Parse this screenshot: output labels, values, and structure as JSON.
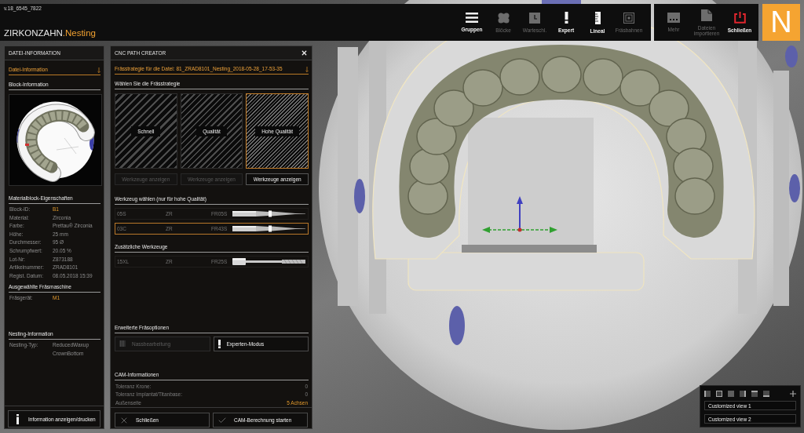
{
  "version": "v.18_6545_7822",
  "app_name": {
    "brand": "ZIRKONZAHN",
    "product": ".Nesting"
  },
  "toolbar": [
    {
      "label": "Gruppen",
      "kind": "groups",
      "disabled": false
    },
    {
      "label": "Blöcke",
      "kind": "blocks",
      "disabled": true
    },
    {
      "label": "Warteschl.",
      "kind": "queue",
      "disabled": true
    },
    {
      "label": "Expert",
      "kind": "expert",
      "disabled": false
    },
    {
      "label": "Lineal",
      "kind": "ruler",
      "disabled": false
    },
    {
      "label": "Fräsbahnen",
      "kind": "paths",
      "disabled": true
    }
  ],
  "side_toolbar": [
    {
      "label": "Mehr",
      "kind": "more",
      "disabled": true
    },
    {
      "label": "Dateien importieren",
      "kind": "import",
      "disabled": true
    },
    {
      "label": "Schließen",
      "kind": "power",
      "disabled": false
    }
  ],
  "logo": "N",
  "file_info_panel": {
    "title": "DATEI-INFORMATION",
    "file_section": "Datei-Information",
    "block_section": "Block-Information",
    "material_section": "Materialblock-Eigenschaften",
    "material_rows": [
      {
        "label": "Block-ID:",
        "value": "B1",
        "highlighted": true
      },
      {
        "label": "Material:",
        "value": "Zirconia",
        "highlighted": false
      },
      {
        "label": "Farbe:",
        "value": "Prettau® Zirconia",
        "highlighted": false
      },
      {
        "label": "Höhe:",
        "value": "25 mm",
        "highlighted": false
      },
      {
        "label": "Durchmesser:",
        "value": "95 Ø",
        "highlighted": false
      },
      {
        "label": "Schrumpfwert:",
        "value": "20.05 %",
        "highlighted": false
      },
      {
        "label": "Lot-Nr:",
        "value": "Z873188",
        "highlighted": false
      },
      {
        "label": "Artikelnummer:",
        "value": "ZRAD8101",
        "highlighted": false
      },
      {
        "label": "Regist. Datum:",
        "value": "08.05.2018 15:39",
        "highlighted": false
      }
    ],
    "machine_section": "Ausgewählte Fräsmaschine",
    "machine_rows": [
      {
        "label": "Fräsgerät:",
        "value": "M1",
        "highlighted": true
      }
    ],
    "nesting_section": "Nesting-Information",
    "nesting_rows": [
      {
        "label": "Nesting-Typ:",
        "value": "ReducedWaxup CrownBottom",
        "highlighted": false
      }
    ],
    "print_button": "Information anzeigen/drucken"
  },
  "cnc_panel": {
    "title": "CNC PATH CREATOR",
    "file_heading": "Frässtrategie für die Datei: 81_ZRAD8101_Nesting_2018-05-28_17-53-35",
    "strategy_heading": "Wählen Sie die Frässtrategie",
    "strategies": [
      {
        "label": "Schnell",
        "selected": false,
        "tools_button": {
          "label": "Werkzeuge anzeigen",
          "disabled": true
        }
      },
      {
        "label": "Qualität",
        "selected": false,
        "tools_button": {
          "label": "Werkzeuge anzeigen",
          "disabled": true
        }
      },
      {
        "label": "Hohe Qualität",
        "selected": true,
        "tools_button": {
          "label": "Werkzeuge anzeigen",
          "disabled": false
        }
      }
    ],
    "tool_heading": "Werkzeug wählen (nur für hohe Qualität)",
    "tools": [
      {
        "code": "05S",
        "material": "ZR",
        "name": "FR05S",
        "kind": "tapered",
        "selected": false
      },
      {
        "code": "03C",
        "material": "ZR",
        "name": "FR43S",
        "kind": "tapered",
        "selected": true
      }
    ],
    "extra_heading": "Zusätzliche Werkzeuge",
    "extra_tools": [
      {
        "code": "15XL",
        "material": "ZR",
        "name": "FR25S",
        "kind": "shank",
        "selected": false
      }
    ],
    "options_heading": "Erweiterte Fräsoptionen",
    "options": [
      {
        "label": "Nassbearbeitung",
        "kind": "wet",
        "disabled": true
      },
      {
        "label": "Experten-Modus",
        "kind": "expert",
        "disabled": false
      }
    ],
    "cam_heading": "CAM-Informationen",
    "cam_rows": [
      {
        "label": "Toleranz Krone:",
        "value": "0",
        "highlighted": false
      },
      {
        "label": "Toleranz Implantat/Titanbase:",
        "value": "0",
        "highlighted": false
      },
      {
        "label": "Außenseite",
        "value": "5 Achsen",
        "highlighted": true
      }
    ],
    "buttons": [
      {
        "label": "Schließen",
        "kind": "close"
      },
      {
        "label": "CAM-Berechnung starten",
        "kind": "confirm"
      }
    ]
  },
  "view_panel": {
    "buttons": [
      {
        "kind": "edge-left"
      },
      {
        "kind": "outline"
      },
      {
        "kind": "fill"
      },
      {
        "kind": "edge-right"
      },
      {
        "kind": "edge-top"
      },
      {
        "kind": "edge-bottom"
      },
      {
        "kind": "plus"
      }
    ],
    "presets": [
      "Customized view 1",
      "Customized view 2"
    ]
  }
}
